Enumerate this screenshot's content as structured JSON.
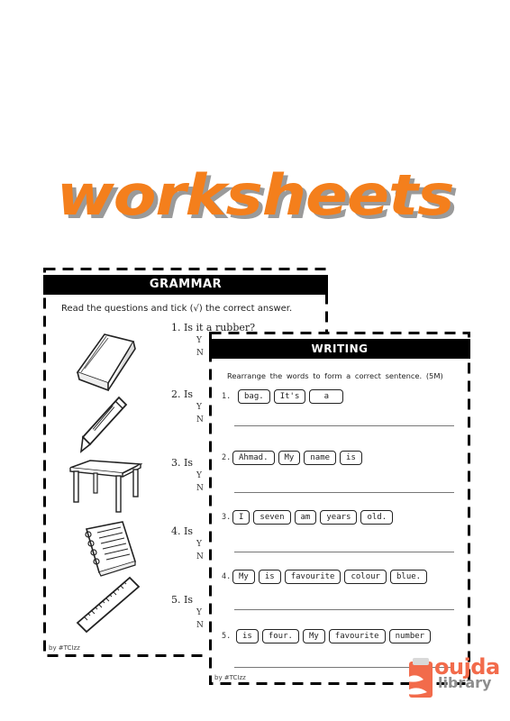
{
  "headline": "worksheets",
  "colors": {
    "headline": "#f47f1c",
    "headline_shadow": "#9a9a9a",
    "logo_orange": "#f26b4b",
    "logo_gray": "#8d8d8d"
  },
  "grammar": {
    "title": "GRAMMAR",
    "instruction": "Read the questions and tick (√) the correct answer.",
    "questions": [
      {
        "label": "1. Is it a rubber?",
        "picture": "book-icon"
      },
      {
        "label": "2. Is",
        "picture": "pen-icon"
      },
      {
        "label": "3. Is",
        "picture": "table-icon"
      },
      {
        "label": "4. Is",
        "picture": "notebook-icon"
      },
      {
        "label": "5. Is",
        "picture": "ruler-icon"
      }
    ],
    "choices": [
      "Y",
      "N"
    ],
    "credit": "by #TCIzz"
  },
  "writing": {
    "title": "WRITING",
    "instruction": "Rearrange the words to form a correct sentence. (5M)",
    "items": [
      {
        "number": "1.",
        "words": [
          "bag.",
          "It's",
          "a"
        ]
      },
      {
        "number": "2.",
        "words": [
          "Ahmad.",
          "My",
          "name",
          "is"
        ]
      },
      {
        "number": "3.",
        "words": [
          "I",
          "seven",
          "am",
          "years",
          "old."
        ]
      },
      {
        "number": "4.",
        "words": [
          "My",
          "is",
          "favourite",
          "colour",
          "blue."
        ]
      },
      {
        "number": "5.",
        "words": [
          "is",
          "four.",
          "My",
          "favourite",
          "number"
        ]
      }
    ],
    "credit": "by #TCIzz"
  },
  "logo": {
    "line1": "oujda",
    "line2": "library",
    "icon": "book-hands-icon"
  }
}
